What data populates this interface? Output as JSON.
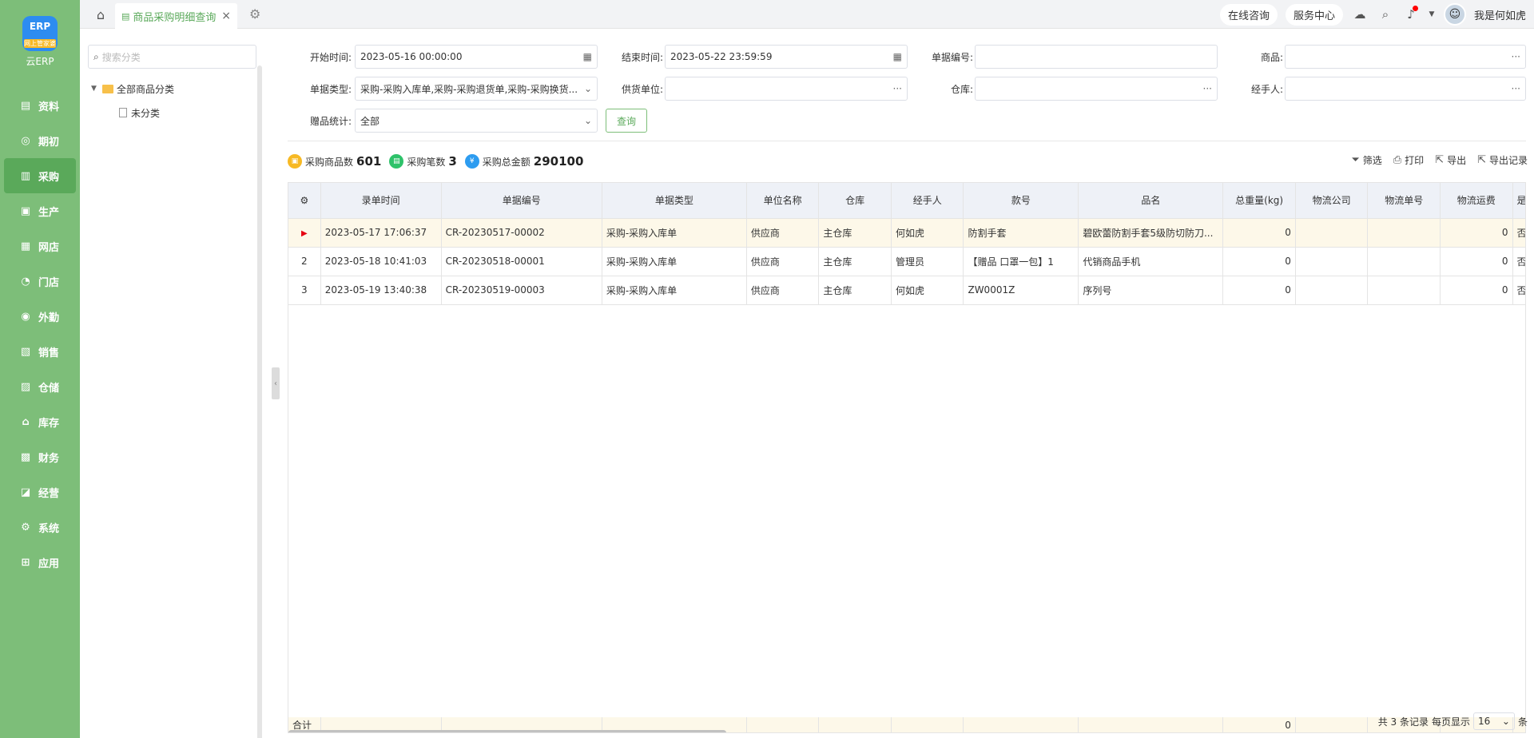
{
  "app": {
    "logo_text": "云ERP",
    "logo_badge": "网上管家婆",
    "logo_mark": "ERP"
  },
  "nav": [
    {
      "label": "资料",
      "icon": "document-icon"
    },
    {
      "label": "期初",
      "icon": "target-icon"
    },
    {
      "label": "采购",
      "icon": "purchase-icon",
      "active": true
    },
    {
      "label": "生产",
      "icon": "production-icon"
    },
    {
      "label": "网店",
      "icon": "shop-icon"
    },
    {
      "label": "门店",
      "icon": "pie-icon"
    },
    {
      "label": "外勤",
      "icon": "field-icon"
    },
    {
      "label": "销售",
      "icon": "chart-icon"
    },
    {
      "label": "仓储",
      "icon": "warehouse-icon"
    },
    {
      "label": "库存",
      "icon": "home-icon"
    },
    {
      "label": "财务",
      "icon": "finance-icon"
    },
    {
      "label": "经营",
      "icon": "business-icon"
    },
    {
      "label": "系统",
      "icon": "system-icon"
    },
    {
      "label": "应用",
      "icon": "app-icon"
    }
  ],
  "topbar": {
    "tab_label": "商品采购明细查询",
    "consult": "在线咨询",
    "service": "服务中心",
    "username": "我是何如虎"
  },
  "category": {
    "search_placeholder": "搜索分类",
    "root": "全部商品分类",
    "child": "未分类"
  },
  "filters": {
    "start_label": "开始时间:",
    "start_value": "2023-05-16 00:00:00",
    "end_label": "结束时间:",
    "end_value": "2023-05-22 23:59:59",
    "billno_label": "单据编号:",
    "billno_value": "",
    "goods_label": "商品:",
    "goods_value": "",
    "billtype_label": "单据类型:",
    "billtype_value": "采购-采购入库单,采购-采购退货单,采购-采购换货...",
    "supplier_label": "供货单位:",
    "supplier_value": "",
    "warehouse_label": "仓库:",
    "warehouse_value": "",
    "handler_label": "经手人:",
    "handler_value": "",
    "gift_label": "赠品统计:",
    "gift_value": "全部",
    "query_button": "查询"
  },
  "stats": {
    "goods_label": "采购商品数",
    "goods_value": "601",
    "bills_label": "采购笔数",
    "bills_value": "3",
    "amount_label": "采购总金额",
    "amount_value": "290100"
  },
  "actions": {
    "filter": "筛选",
    "print": "打印",
    "export": "导出",
    "export_log": "导出记录"
  },
  "table": {
    "headers": [
      "录单时间",
      "单据编号",
      "单据类型",
      "单位名称",
      "仓库",
      "经手人",
      "款号",
      "品名",
      "总重量(kg)",
      "物流公司",
      "物流单号",
      "物流运费",
      "是否"
    ],
    "rows": [
      {
        "idx": "",
        "time": "2023-05-17 17:06:37",
        "no": "CR-20230517-00002",
        "type": "采购-采购入库单",
        "unit": "供应商",
        "wh": "主仓库",
        "handler": "何如虎",
        "style": "防割手套",
        "name": "碧欧蕾防割手套5级防切防刀...",
        "weight": "0",
        "company": "",
        "track": "",
        "fee": "0",
        "flag": "否"
      },
      {
        "idx": "2",
        "time": "2023-05-18 10:41:03",
        "no": "CR-20230518-00001",
        "type": "采购-采购入库单",
        "unit": "供应商",
        "wh": "主仓库",
        "handler": "管理员",
        "style": "【赠品 口罩一包】1",
        "name": "代销商品手机",
        "weight": "0",
        "company": "",
        "track": "",
        "fee": "0",
        "flag": "否"
      },
      {
        "idx": "3",
        "time": "2023-05-19 13:40:38",
        "no": "CR-20230519-00003",
        "type": "采购-采购入库单",
        "unit": "供应商",
        "wh": "主仓库",
        "handler": "何如虎",
        "style": "ZW0001Z",
        "name": "序列号",
        "weight": "0",
        "company": "",
        "track": "",
        "fee": "0",
        "flag": "否"
      }
    ],
    "total_label": "合计",
    "total_weight": "0"
  },
  "pager": {
    "summary": "共 3 条记录",
    "per_page_label": "每页显示",
    "per_page_value": "16",
    "unit": "条"
  },
  "colors": {
    "sidebar": "#7dbe79",
    "accent": "#5aa95a",
    "header_bg": "#eef1f7",
    "selected_row": "#fdf8e9"
  }
}
